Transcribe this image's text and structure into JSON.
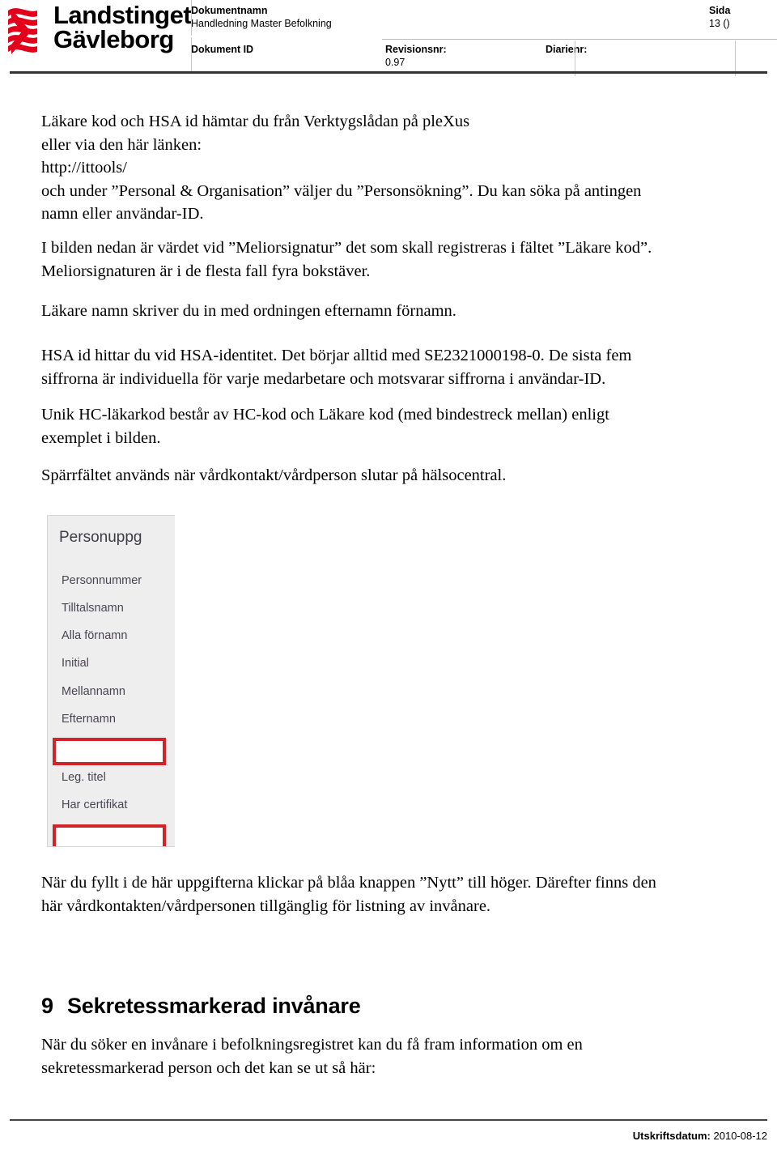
{
  "header": {
    "logo": {
      "line1": "Landstinget",
      "line2": "Gävleborg",
      "mark_color": "#e2001a",
      "mark_name": "landstinget-wave-mark"
    },
    "fields": {
      "dokumentnamn_label": "Dokumentnamn",
      "dokumentnamn_value": "Handledning Master Befolkning",
      "sida_label": "Sida",
      "sida_value": "13 ()",
      "dokument_id_label": "Dokument ID",
      "dokument_id_value": "",
      "revisionsnr_label": "Revisionsnr:",
      "revisionsnr_value": "0.97",
      "diarienr_label": "Diarienr:",
      "diarienr_value": ""
    }
  },
  "body": {
    "paragraph_1": {
      "line_1": "Läkare kod och HSA id hämtar du från Verktygslådan på pleXus",
      "line_2": "eller via den här länken:",
      "line_3": "http://ittools/",
      "line_4": "och under ”Personal & Organisation” väljer du ”Personsökning”. Du kan söka på antingen",
      "line_5": "namn eller användar-ID."
    },
    "paragraph_2": {
      "line_1": "I bilden nedan är värdet vid ”Meliorsignatur” det som skall registreras i fältet ”Läkare kod”.",
      "line_2": "Meliorsignaturen är i de flesta fall fyra bokstäver."
    },
    "paragraph_3": {
      "line_1": "Läkare namn skriver du in med ordningen efternamn förnamn."
    },
    "paragraph_4": {
      "line_1": "HSA id hittar du vid HSA-identitet. Det börjar alltid med SE2321000198-0. De sista fem",
      "line_2": "siffrorna är individuella för varje medarbetare och motsvarar siffrorna i användar-ID."
    },
    "paragraph_5": {
      "line_1": "Unik HC-läkarkod består av HC-kod och Läkare kod (med bindestreck mellan) enligt",
      "line_2": "exemplet i bilden."
    },
    "paragraph_6": {
      "line_1": "Spärrfältet används när vårdkontakt/vårdperson slutar på hälsocentral."
    },
    "paragraph_7": {
      "line_1": "När du fyllt i de här uppgifterna klickar på blåa knappen ”Nytt” till höger. Därefter finns den",
      "line_2": "här vårdkontakten/vårdpersonen tillgänglig för listning av invånare."
    },
    "heading_9": {
      "number": "9",
      "text": "Sekretessmarkerad invånare"
    },
    "paragraph_8": {
      "line_1": "När du söker en invånare i befolkningsregistret kan du få fram information om en",
      "line_2": "sekretessmarkerad person och det kan se ut så här:"
    }
  },
  "embedded_form": {
    "title": "Personuppg",
    "labels": [
      "Personnummer",
      "Tilltalsnamn",
      "Alla förnamn",
      "Initial",
      "Mellannamn",
      "Efternamn",
      "Leg. titel",
      "Har certifikat"
    ],
    "highlight_color": "#d3232a",
    "panel_background": "#eeeeee"
  },
  "footer": {
    "label": "Utskriftsdatum:",
    "value": "2010-08-12"
  }
}
